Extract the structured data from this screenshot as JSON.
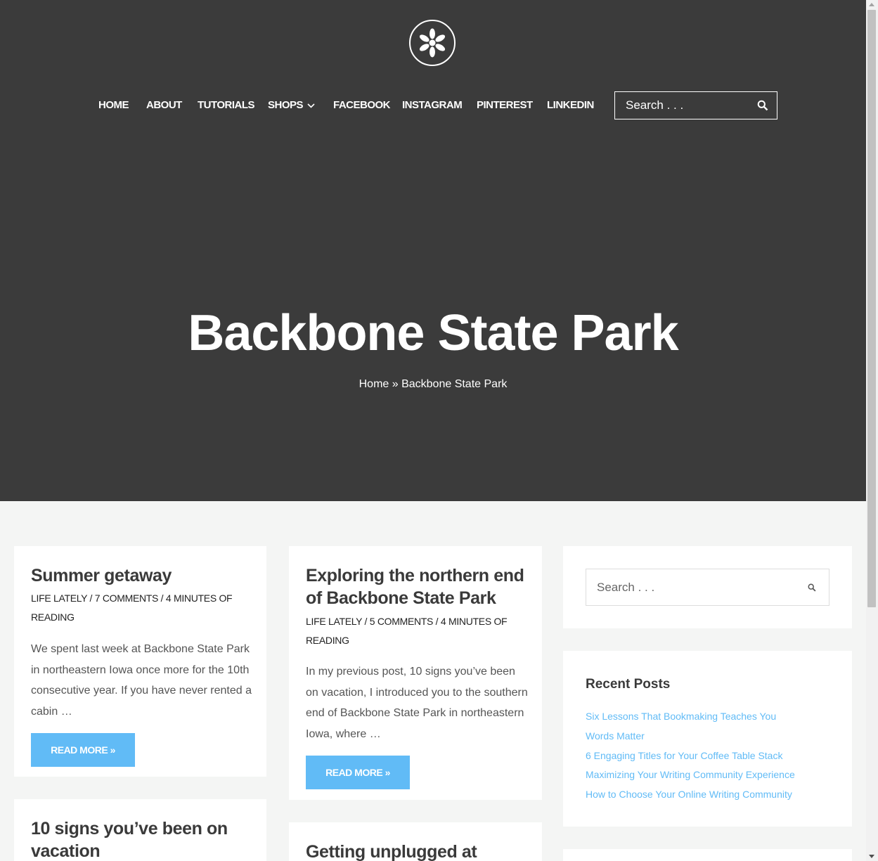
{
  "nav": {
    "items": [
      {
        "label": "HOME"
      },
      {
        "label": "ABOUT"
      },
      {
        "label": "TUTORIALS"
      },
      {
        "label": "SHOPS"
      },
      {
        "label": "FACEBOOK"
      },
      {
        "label": "INSTAGRAM"
      },
      {
        "label": "PINTEREST"
      },
      {
        "label": "LINKEDIN"
      }
    ],
    "search_placeholder": "Search . . ."
  },
  "hero": {
    "title": "Backbone State Park",
    "breadcrumb": "Home » Backbone State Park"
  },
  "posts": [
    {
      "title": "Summer getaway",
      "category": "LIFE LATELY",
      "comments": "7 COMMENTS",
      "reading": "4 MINUTES OF READING",
      "excerpt": "We spent last week at Backbone State Park in northeastern Iowa once more for the 10th consecutive year. If you have never rented a cabin …",
      "button": "READ MORE »"
    },
    {
      "title": "Exploring the northern end of Backbone State Park",
      "category": "LIFE LATELY",
      "comments": "5 COMMENTS",
      "reading": "4 MINUTES OF READING",
      "excerpt": "In my previous post, 10 signs you’ve been on vacation, I introduced you to the southern end of Backbone State Park in northeastern Iowa, where …",
      "button": "READ MORE »"
    },
    {
      "title": "10 signs you’ve been on vacation"
    },
    {
      "title": "Getting unplugged at"
    }
  ],
  "sidebar": {
    "search_placeholder": "Search . . .",
    "recent_posts": {
      "title": "Recent Posts",
      "items": [
        "Six Lessons That Bookmaking Teaches You",
        "Words Matter",
        "6 Engaging Titles for Your Coffee Table Stack",
        "Maximizing Your Writing Community Experience",
        "How to Choose Your Online Writing Community"
      ]
    }
  },
  "colors": {
    "header_bg": "#3b3b3b",
    "page_bg": "#f4f5f4",
    "accent": "#61bbf6",
    "title_text": "#3a3a3a"
  }
}
